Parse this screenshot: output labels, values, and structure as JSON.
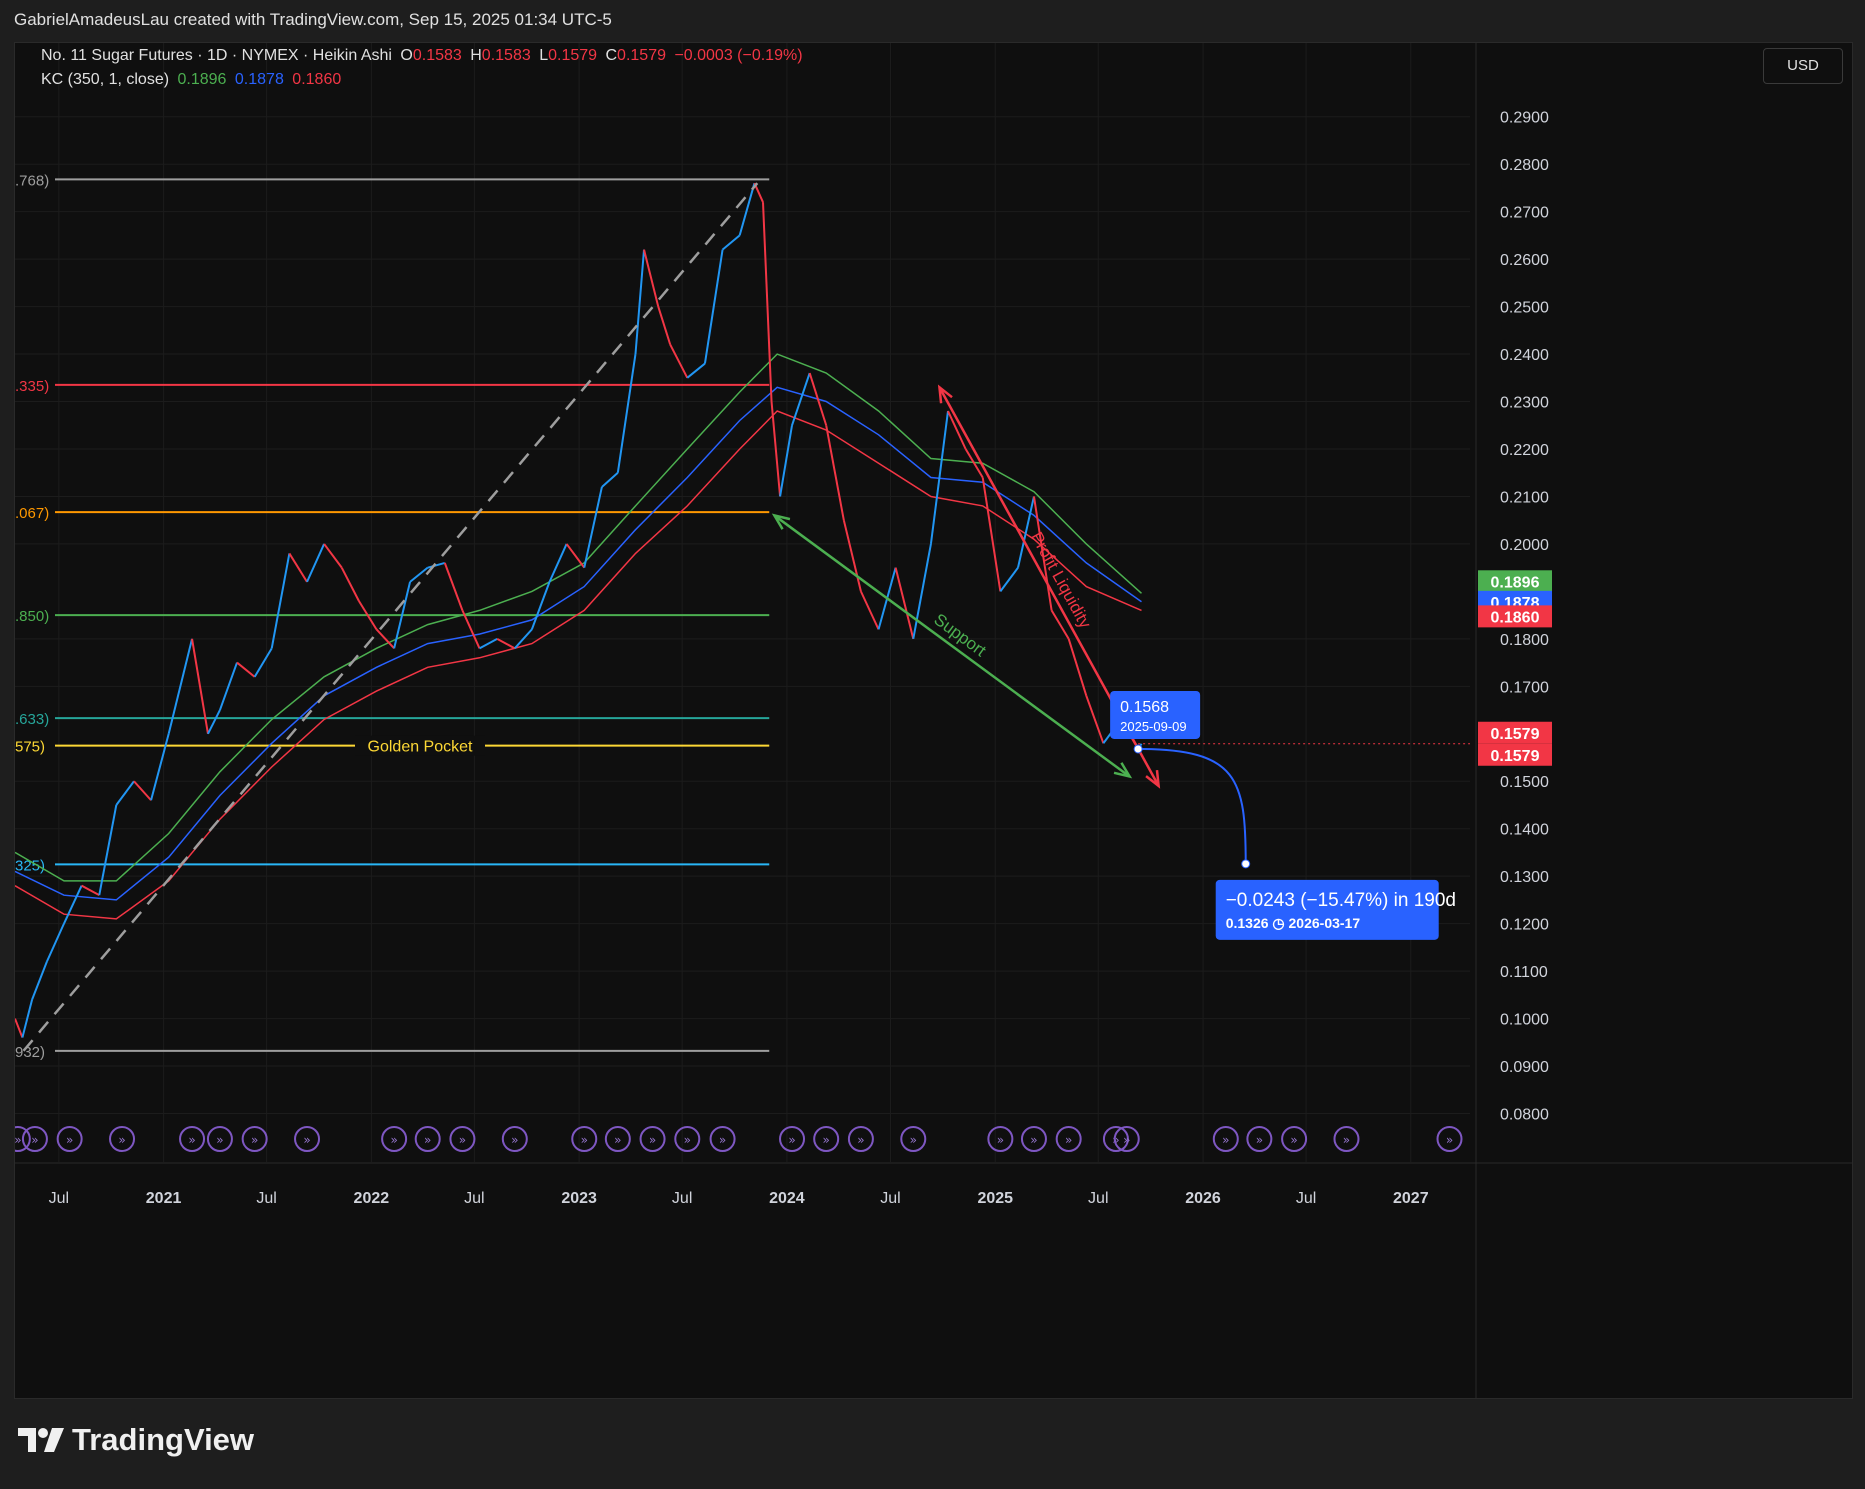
{
  "header": {
    "text": "GabrielAmadeusLau created with TradingView.com, Sep 15, 2025 01:34 UTC-5"
  },
  "legend": {
    "symbol": "No. 11 Sugar Futures · 1D · NYMEX · Heikin Ashi",
    "o_label": "O",
    "o": "0.1583",
    "h_label": "H",
    "h": "0.1583",
    "l_label": "L",
    "l": "0.1579",
    "c_label": "C",
    "c": "0.1579",
    "change": "−0.0003 (−0.19%)",
    "kc_label": "KC (350, 1, close)",
    "kc_upper": "0.1896",
    "kc_mid": "0.1878",
    "kc_lower": "0.1860"
  },
  "currency_button": "USD",
  "footer": {
    "brand": "TradingView"
  },
  "colors": {
    "up": "#26a69a",
    "candle_up": "#2196f3",
    "candle_down": "#f23645",
    "kc_upper": "#4caf50",
    "kc_mid": "#2962ff",
    "kc_lower": "#f23645",
    "projection": "#2962ff",
    "label_red": "#f23645",
    "golden": "#fdd835"
  },
  "chart_data": {
    "type": "line",
    "title": "No. 11 Sugar Futures · 1D · NYMEX · Heikin Ashi",
    "y_range": [
      0.078,
      0.295
    ],
    "y_ticks": [
      "0.2900",
      "0.2800",
      "0.2700",
      "0.2600",
      "0.2500",
      "0.2400",
      "0.2300",
      "0.2200",
      "0.2100",
      "0.2000",
      "0.1800",
      "0.1700",
      "0.1500",
      "0.1400",
      "0.1300",
      "0.1200",
      "0.1100",
      "0.1000",
      "0.0900",
      "0.0800"
    ],
    "x_ticks": [
      "Jul",
      "2021",
      "Jul",
      "2022",
      "Jul",
      "2023",
      "Jul",
      "2024",
      "Jul",
      "2025",
      "Jul",
      "2026",
      "Jul",
      "2027"
    ],
    "x_range": [
      "2020-04-15",
      "2027-04-15"
    ],
    "price_series": [
      [
        "2020-04-15",
        0.1
      ],
      [
        "2020-04-28",
        0.096
      ],
      [
        "2020-05-15",
        0.104
      ],
      [
        "2020-06-10",
        0.112
      ],
      [
        "2020-07-10",
        0.12
      ],
      [
        "2020-08-10",
        0.128
      ],
      [
        "2020-09-10",
        0.126
      ],
      [
        "2020-10-10",
        0.145
      ],
      [
        "2020-11-10",
        0.15
      ],
      [
        "2020-12-10",
        0.146
      ],
      [
        "2021-01-10",
        0.16
      ],
      [
        "2021-02-20",
        0.18
      ],
      [
        "2021-03-20",
        0.16
      ],
      [
        "2021-04-10",
        0.165
      ],
      [
        "2021-05-10",
        0.175
      ],
      [
        "2021-06-10",
        0.172
      ],
      [
        "2021-07-10",
        0.178
      ],
      [
        "2021-08-10",
        0.198
      ],
      [
        "2021-09-10",
        0.192
      ],
      [
        "2021-10-10",
        0.2
      ],
      [
        "2021-11-10",
        0.195
      ],
      [
        "2021-12-10",
        0.188
      ],
      [
        "2022-01-10",
        0.182
      ],
      [
        "2022-02-10",
        0.178
      ],
      [
        "2022-03-10",
        0.192
      ],
      [
        "2022-04-10",
        0.195
      ],
      [
        "2022-05-10",
        0.196
      ],
      [
        "2022-06-10",
        0.186
      ],
      [
        "2022-07-10",
        0.178
      ],
      [
        "2022-08-10",
        0.18
      ],
      [
        "2022-09-10",
        0.178
      ],
      [
        "2022-10-10",
        0.182
      ],
      [
        "2022-11-10",
        0.192
      ],
      [
        "2022-12-10",
        0.2
      ],
      [
        "2023-01-10",
        0.195
      ],
      [
        "2023-02-10",
        0.212
      ],
      [
        "2023-03-10",
        0.215
      ],
      [
        "2023-04-10",
        0.24
      ],
      [
        "2023-04-25",
        0.262
      ],
      [
        "2023-05-20",
        0.25
      ],
      [
        "2023-06-10",
        0.242
      ],
      [
        "2023-07-10",
        0.235
      ],
      [
        "2023-08-10",
        0.238
      ],
      [
        "2023-09-10",
        0.262
      ],
      [
        "2023-10-10",
        0.265
      ],
      [
        "2023-11-05",
        0.276
      ],
      [
        "2023-11-20",
        0.272
      ],
      [
        "2023-12-05",
        0.23
      ],
      [
        "2023-12-20",
        0.21
      ],
      [
        "2024-01-10",
        0.225
      ],
      [
        "2024-02-10",
        0.236
      ],
      [
        "2024-03-10",
        0.225
      ],
      [
        "2024-04-10",
        0.205
      ],
      [
        "2024-05-10",
        0.19
      ],
      [
        "2024-06-10",
        0.182
      ],
      [
        "2024-07-10",
        0.195
      ],
      [
        "2024-08-10",
        0.18
      ],
      [
        "2024-09-10",
        0.2
      ],
      [
        "2024-10-10",
        0.228
      ],
      [
        "2024-11-10",
        0.22
      ],
      [
        "2024-12-10",
        0.214
      ],
      [
        "2025-01-10",
        0.19
      ],
      [
        "2025-02-10",
        0.195
      ],
      [
        "2025-03-10",
        0.21
      ],
      [
        "2025-04-10",
        0.186
      ],
      [
        "2025-05-10",
        0.18
      ],
      [
        "2025-06-10",
        0.168
      ],
      [
        "2025-07-10",
        0.158
      ],
      [
        "2025-08-10",
        0.163
      ],
      [
        "2025-09-09",
        0.1568
      ],
      [
        "2025-09-15",
        0.1579
      ]
    ],
    "kc_upper": [
      [
        "2020-04-15",
        0.135
      ],
      [
        "2020-07-10",
        0.129
      ],
      [
        "2020-10-10",
        0.129
      ],
      [
        "2021-01-10",
        0.139
      ],
      [
        "2021-04-10",
        0.152
      ],
      [
        "2021-07-10",
        0.163
      ],
      [
        "2021-10-10",
        0.172
      ],
      [
        "2022-01-10",
        0.178
      ],
      [
        "2022-04-10",
        0.183
      ],
      [
        "2022-07-10",
        0.186
      ],
      [
        "2022-10-10",
        0.19
      ],
      [
        "2023-01-10",
        0.196
      ],
      [
        "2023-04-10",
        0.208
      ],
      [
        "2023-07-10",
        0.22
      ],
      [
        "2023-10-10",
        0.232
      ],
      [
        "2023-12-15",
        0.24
      ],
      [
        "2024-03-10",
        0.236
      ],
      [
        "2024-06-10",
        0.228
      ],
      [
        "2024-09-10",
        0.218
      ],
      [
        "2024-12-10",
        0.217
      ],
      [
        "2025-03-10",
        0.211
      ],
      [
        "2025-06-10",
        0.2
      ],
      [
        "2025-09-15",
        0.1896
      ]
    ],
    "kc_mid": [
      [
        "2020-04-15",
        0.131
      ],
      [
        "2020-07-10",
        0.126
      ],
      [
        "2020-10-10",
        0.125
      ],
      [
        "2021-01-10",
        0.134
      ],
      [
        "2021-04-10",
        0.147
      ],
      [
        "2021-07-10",
        0.158
      ],
      [
        "2021-10-10",
        0.168
      ],
      [
        "2022-01-10",
        0.174
      ],
      [
        "2022-04-10",
        0.179
      ],
      [
        "2022-07-10",
        0.181
      ],
      [
        "2022-10-10",
        0.184
      ],
      [
        "2023-01-10",
        0.191
      ],
      [
        "2023-04-10",
        0.203
      ],
      [
        "2023-07-10",
        0.214
      ],
      [
        "2023-10-10",
        0.226
      ],
      [
        "2023-12-15",
        0.233
      ],
      [
        "2024-03-10",
        0.23
      ],
      [
        "2024-06-10",
        0.223
      ],
      [
        "2024-09-10",
        0.214
      ],
      [
        "2024-12-10",
        0.213
      ],
      [
        "2025-03-10",
        0.206
      ],
      [
        "2025-06-10",
        0.196
      ],
      [
        "2025-09-15",
        0.1878
      ]
    ],
    "kc_lower": [
      [
        "2020-04-15",
        0.128
      ],
      [
        "2020-07-10",
        0.122
      ],
      [
        "2020-10-10",
        0.121
      ],
      [
        "2021-01-10",
        0.129
      ],
      [
        "2021-04-10",
        0.142
      ],
      [
        "2021-07-10",
        0.153
      ],
      [
        "2021-10-10",
        0.163
      ],
      [
        "2022-01-10",
        0.169
      ],
      [
        "2022-04-10",
        0.174
      ],
      [
        "2022-07-10",
        0.176
      ],
      [
        "2022-10-10",
        0.179
      ],
      [
        "2023-01-10",
        0.186
      ],
      [
        "2023-04-10",
        0.198
      ],
      [
        "2023-07-10",
        0.208
      ],
      [
        "2023-10-10",
        0.22
      ],
      [
        "2023-12-15",
        0.228
      ],
      [
        "2024-03-10",
        0.224
      ],
      [
        "2024-06-10",
        0.217
      ],
      [
        "2024-09-10",
        0.21
      ],
      [
        "2024-12-10",
        0.208
      ],
      [
        "2025-03-10",
        0.201
      ],
      [
        "2025-06-10",
        0.191
      ],
      [
        "2025-09-15",
        0.186
      ]
    ],
    "fib_levels": [
      {
        "label": ".768)",
        "value": 0.2768,
        "color": "#9e9e9e"
      },
      {
        "label": ".335)",
        "value": 0.2335,
        "color": "#f23645"
      },
      {
        "label": ".067)",
        "value": 0.2067,
        "color": "#ff9800"
      },
      {
        "label": ".850)",
        "value": 0.185,
        "color": "#4caf50"
      },
      {
        "label": ".633)",
        "value": 0.1633,
        "color": "#26a69a"
      },
      {
        "label": "575)",
        "value": 0.1575,
        "color": "#fdd835"
      },
      {
        "label": "325)",
        "value": 0.1325,
        "color": "#29b6f6"
      },
      {
        "label": "932)",
        "value": 0.0932,
        "color": "#9e9e9e"
      }
    ],
    "fib_x_range": [
      "2020-04-15",
      "2023-12-01"
    ],
    "golden_pocket_label": "Golden Pocket",
    "trendlines": [
      {
        "name": "dashed",
        "from": [
          "2020-04-30",
          0.0932
        ],
        "to": [
          "2023-11-10",
          0.276
        ],
        "color": "#9e9e9e",
        "dashed": true
      },
      {
        "name": "Support",
        "from": [
          "2023-12-10",
          0.206
        ],
        "to": [
          "2025-08-25",
          0.151
        ],
        "color": "#4caf50",
        "label": "Support"
      },
      {
        "name": "Profit Liquidity",
        "from": [
          "2024-09-25",
          0.233
        ],
        "to": [
          "2025-10-15",
          0.149
        ],
        "color": "#f23645",
        "label": "Profit Liquidity"
      }
    ],
    "projection": {
      "from": [
        "2025-09-09",
        0.1568
      ],
      "to": [
        "2026-03-17",
        0.1326
      ],
      "start_label_price": "0.1568",
      "start_label_date": "2025-09-09",
      "result_line1": "−0.0243 (−15.47%) in 190d",
      "result_price": "0.1326",
      "result_date": "2026-03-17"
    },
    "price_labels": [
      {
        "text": "0.1896",
        "value": 0.1896,
        "color": "#4caf50"
      },
      {
        "text": "0.1878",
        "value": 0.1878,
        "color": "#2962ff"
      },
      {
        "text": "0.1860",
        "value": 0.186,
        "color": "#f23645"
      },
      {
        "text": "0.1579",
        "value": 0.1579,
        "color": "#f23645",
        "offset": -1
      },
      {
        "text": "0.1579",
        "value": 0.1579,
        "color": "#f23645",
        "offset": 1
      }
    ],
    "event_marker_dates": [
      "2020-04-20",
      "2020-05-20",
      "2020-07-20",
      "2020-10-20",
      "2021-02-20",
      "2021-04-10",
      "2021-06-10",
      "2021-09-10",
      "2022-02-10",
      "2022-04-10",
      "2022-06-10",
      "2022-09-10",
      "2023-01-10",
      "2023-03-10",
      "2023-05-10",
      "2023-07-10",
      "2023-09-10",
      "2024-01-10",
      "2024-03-10",
      "2024-05-10",
      "2024-08-10",
      "2025-01-10",
      "2025-03-10",
      "2025-05-10",
      "2025-08-01",
      "2025-08-20",
      "2026-02-10",
      "2026-04-10",
      "2026-06-10",
      "2026-09-10",
      "2027-03-10"
    ]
  }
}
